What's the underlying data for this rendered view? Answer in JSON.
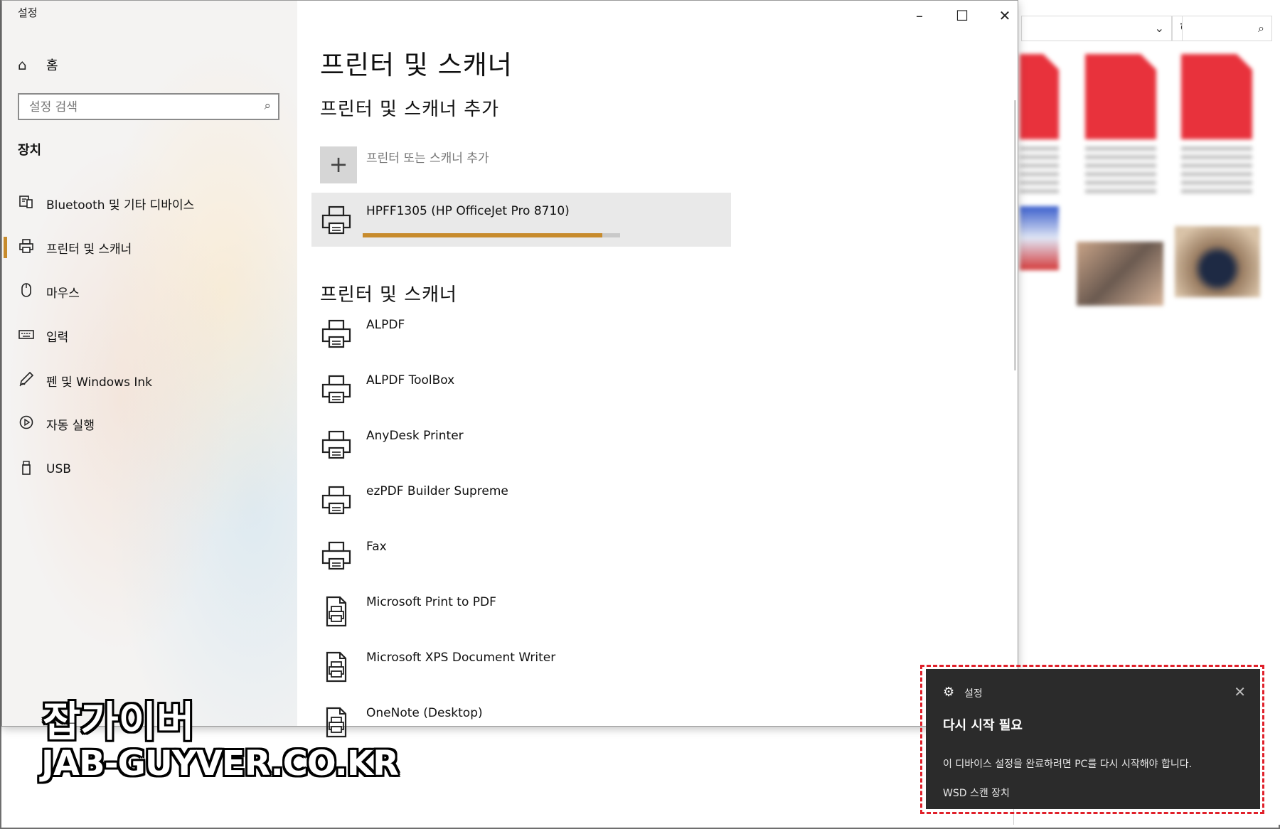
{
  "window": {
    "title": "설정"
  },
  "sidebar": {
    "home_label": "홈",
    "search_placeholder": "설정 검색",
    "section_title": "장치",
    "items": [
      {
        "label": "Bluetooth 및 기타 디바이스",
        "icon": "bluetooth-device-icon"
      },
      {
        "label": "프린터 및 스캐너",
        "icon": "printer-icon",
        "active": true
      },
      {
        "label": "마우스",
        "icon": "mouse-icon"
      },
      {
        "label": "입력",
        "icon": "keyboard-icon"
      },
      {
        "label": "펜 및 Windows Ink",
        "icon": "pen-icon"
      },
      {
        "label": "자동 실행",
        "icon": "autoplay-icon"
      },
      {
        "label": "USB",
        "icon": "usb-icon"
      }
    ]
  },
  "main": {
    "title": "프린터 및 스캐너",
    "add_section_title": "프린터 및 스캐너 추가",
    "add_button_label": "프린터 또는 스캐너 추가",
    "installing_printer": {
      "name": "HPFF1305 (HP OfficeJet Pro 8710)",
      "progress_percent": 93
    },
    "list_title": "프린터 및 스캐너",
    "printers": [
      {
        "name": "ALPDF",
        "icon": "printer-icon"
      },
      {
        "name": "ALPDF ToolBox",
        "icon": "printer-icon"
      },
      {
        "name": "AnyDesk Printer",
        "icon": "printer-icon"
      },
      {
        "name": "ezPDF Builder Supreme",
        "icon": "printer-icon"
      },
      {
        "name": "Fax",
        "icon": "printer-icon"
      },
      {
        "name": "Microsoft Print to PDF",
        "icon": "document-printer-icon"
      },
      {
        "name": "Microsoft XPS Document Writer",
        "icon": "document-printer-icon"
      },
      {
        "name": "OneNote (Desktop)",
        "icon": "document-printer-icon"
      }
    ]
  },
  "toast": {
    "app_name": "설정",
    "title": "다시 시작 필요",
    "message": "이 디바이스 설정을 완료하려면 PC를 다시 시작해야 합니다.",
    "source": "WSD 스캔 장치"
  },
  "watermark": {
    "korean": "잡가이버",
    "url": "JAB-GUYVER.CO.KR"
  },
  "colors": {
    "accent": "#c78b2c",
    "toast_bg": "#2b2b2b",
    "highlight": "#e0202a"
  }
}
